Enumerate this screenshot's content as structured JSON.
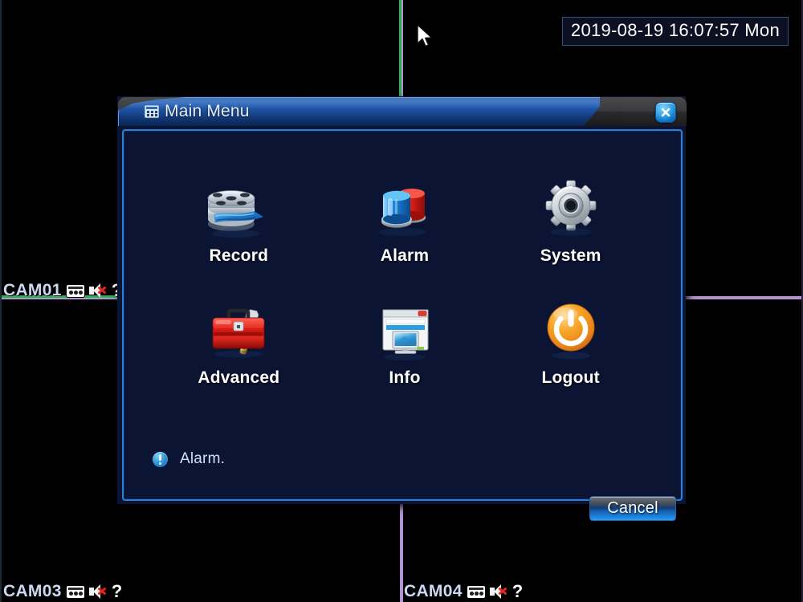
{
  "osd": {
    "clock": "2019-08-19 16:07:57 Mon",
    "cameras": [
      {
        "name": "CAM01",
        "record_icon": "tape-record-icon",
        "audio_icon": "speaker-muted-icon",
        "status_icon": "question-mark-icon"
      },
      {
        "name": "CAM03",
        "record_icon": "tape-record-icon",
        "audio_icon": "speaker-muted-icon",
        "status_icon": "question-mark-icon"
      },
      {
        "name": "CAM04",
        "record_icon": "tape-record-icon",
        "audio_icon": "speaker-muted-icon",
        "status_icon": "question-mark-icon"
      }
    ],
    "question_glyph": "?"
  },
  "dialog": {
    "title": "Main Menu",
    "title_icon": "menu-grid-icon",
    "close_icon": "close-icon",
    "items": [
      {
        "label": "Record",
        "icon": "film-reel-icon"
      },
      {
        "label": "Alarm",
        "icon": "siren-light-icon"
      },
      {
        "label": "System",
        "icon": "gear-icon"
      },
      {
        "label": "Advanced",
        "icon": "toolbox-wrench-icon"
      },
      {
        "label": "Info",
        "icon": "window-monitor-icon"
      },
      {
        "label": "Logout",
        "icon": "power-button-icon"
      }
    ],
    "status": {
      "icon": "info-exclamation-icon",
      "text": "Alarm."
    },
    "cancel_label": "Cancel"
  },
  "colors": {
    "quad_border_active": "#2faf54",
    "quad_border_idle": "#b293d4",
    "dialog_bg": "#0b1533",
    "dialog_border": "#2f7fd6",
    "accent_blue": "#2e9df0",
    "title_blue": "#2464bd",
    "logout_orange": "#f2a030",
    "alarm_red": "#e2261f",
    "text_primary": "#ffffff",
    "text_secondary": "#cfe0fb"
  }
}
